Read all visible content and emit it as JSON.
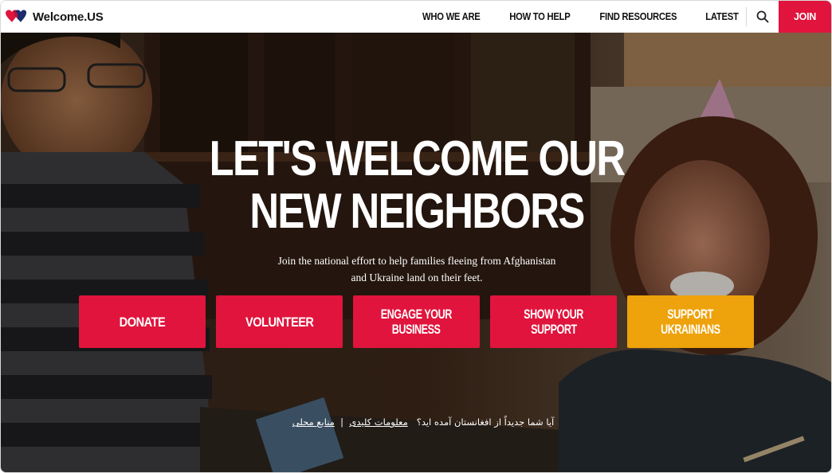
{
  "brand": {
    "name": "Welcome.US",
    "logo_colors": [
      "#e0143c",
      "#1c2b6b"
    ]
  },
  "nav": {
    "links": [
      {
        "label": "WHO WE ARE"
      },
      {
        "label": "HOW TO HELP"
      },
      {
        "label": "FIND RESOURCES"
      },
      {
        "label": "LATEST"
      }
    ],
    "search_icon": "search-icon",
    "join_label": "JOIN",
    "accent": "#e0143c"
  },
  "hero": {
    "headline_line1": "LET'S WELCOME OUR",
    "headline_line2": "NEW NEIGHBORS",
    "subtext_line1": "Join the national effort to help families fleeing from Afghanistan",
    "subtext_line2": "and Ukraine land on their feet.",
    "buttons": [
      {
        "line1": "DONATE",
        "line2": ""
      },
      {
        "line1": "VOLUNTEER",
        "line2": ""
      },
      {
        "line1": "ENGAGE YOUR",
        "line2": "BUSINESS"
      },
      {
        "line1": "SHOW YOUR",
        "line2": "SUPPORT"
      },
      {
        "line1": "SUPPORT",
        "line2": "UKRAINIANS"
      }
    ],
    "button_colors": {
      "primary": "#e0143c",
      "ukraine": "#eea20b"
    }
  },
  "farsi_bar": {
    "question": "آیا شما جدیداً از افغانستان آمده اید؟",
    "link1": "معلومات کلیدی",
    "separator": "|",
    "link2": "منابع محلی"
  }
}
